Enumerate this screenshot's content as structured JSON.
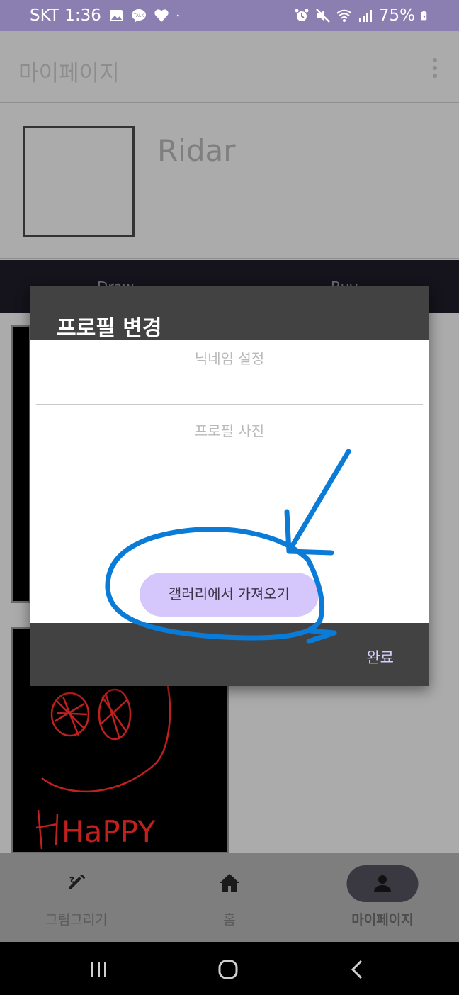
{
  "status_bar": {
    "carrier_time": "SKT 1:36",
    "battery": "75%",
    "icons": [
      "gallery-icon",
      "kakaotalk-icon",
      "heart-icon",
      "dot-icon",
      "alarm-icon",
      "mute-icon",
      "wifi-icon",
      "signal-icon",
      "battery-icon"
    ]
  },
  "app_bar": {
    "title": "마이페이지",
    "menu_icon": "more-vert-icon"
  },
  "profile": {
    "nickname": "Ridar"
  },
  "tabs": [
    {
      "label": "Draw"
    },
    {
      "label": "Buy"
    }
  ],
  "dialog": {
    "title": "프로필 변경",
    "nickname_label": "닉네임 설정",
    "nickname_value": "",
    "photo_label": "프로필 사진",
    "gallery_button": "갤러리에서 가져오기",
    "done_button": "완료",
    "accent": "#d5c7fb"
  },
  "drawing_text": "HaPPY",
  "bottom_nav": [
    {
      "label": "그림그리기",
      "icon": "draw-icon"
    },
    {
      "label": "홈",
      "icon": "home-icon"
    },
    {
      "label": "마이페이지",
      "icon": "person-icon",
      "active": true
    }
  ],
  "system_nav": [
    "recents-icon",
    "home-circle-icon",
    "back-icon"
  ],
  "annotation_color": "#0a7bd6"
}
